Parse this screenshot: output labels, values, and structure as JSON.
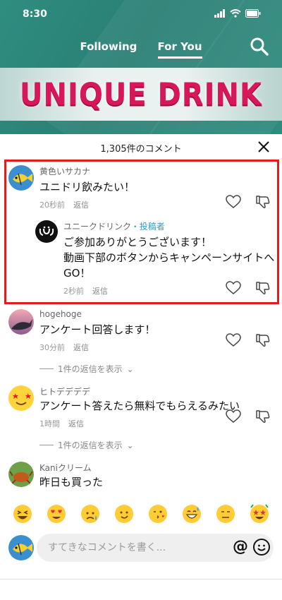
{
  "status": {
    "time": "8:30"
  },
  "nav": {
    "tabs": [
      {
        "label": "Following"
      },
      {
        "label": "For You"
      }
    ],
    "active_tab": "For You"
  },
  "banner": {
    "text": "UNIQUE DRINK"
  },
  "comments_sheet": {
    "title": "1,305件のコメント",
    "comments": [
      {
        "user": "黄色いサカナ",
        "text": "ユニドリ飲みたい！",
        "time": "20秒前",
        "reply": "返信"
      },
      {
        "user": "ユニークドリンク",
        "author_tag": "・投稿者",
        "text_lines": [
          "ご参加ありがとうございます！",
          "動画下部のボタンからキャンペーンサイトへ",
          "GO！"
        ],
        "time": "2秒前",
        "reply": "返信"
      },
      {
        "user": "hogehoge",
        "text": "アンケート回答します！",
        "time": "30分前",
        "reply": "返信",
        "more": "1件の返信を表示"
      },
      {
        "user": "ヒトデデデデ",
        "text": "アンケート答えたら無料でもらえるみたい",
        "time": "1時間",
        "reply": "返信",
        "more": "1件の返信を表示"
      },
      {
        "user": "Kaniクリーム",
        "text": "昨日も買った",
        "time": "",
        "reply": ""
      }
    ]
  },
  "emojis": [
    "laughing-face",
    "heart-eyes-face",
    "worried-sweat-face",
    "smiling-face",
    "kissing-face",
    "grinning-sweat-face",
    "neutral-face",
    "star-struck-face"
  ],
  "composer": {
    "placeholder": "すてきなコメントを書く...",
    "at_label": "@"
  },
  "colors": {
    "header": "#2a7f74",
    "banner_text": "#d8175b",
    "highlight": "#e51a1a",
    "author_tag": "#2a9ec8"
  }
}
